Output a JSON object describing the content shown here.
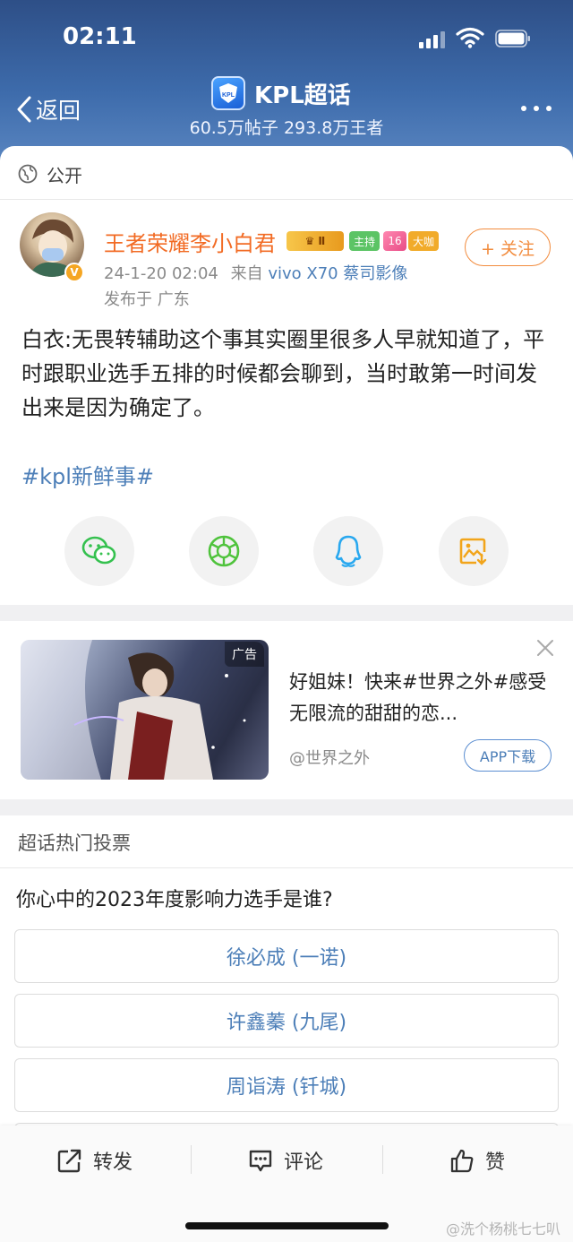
{
  "status_bar": {
    "time": "02:11"
  },
  "header": {
    "back_label": "返回",
    "topic_title": "KPL超话",
    "stats": "60.5万帖子 293.8万王者"
  },
  "post": {
    "visibility": "公开",
    "author": {
      "name": "王者荣耀李小白君",
      "badges": [
        "Ⅱ",
        "主持",
        "16",
        "大咖"
      ]
    },
    "timestamp": "24-1-20 02:04",
    "source_prefix": "来自",
    "source_device": "vivo X70 蔡司影像",
    "location": "发布于 广东",
    "follow_label": "+ 关注",
    "content": "白衣:无畏转辅助这个事其实圈里很多人早就知道了，平时跟职业选手五排的时候都会聊到，当时敢第一时间发出来是因为确定了。",
    "hashtag": "#kpl新鲜事#",
    "share_targets": [
      "wechat-icon",
      "moments-icon",
      "qq-icon",
      "save-image-icon"
    ]
  },
  "ad": {
    "tag": "广告",
    "text": "好姐妹！快来#世界之外#感受无限流的甜甜的恋...",
    "source": "@世界之外",
    "download_label": "APP下载"
  },
  "vote": {
    "section_title": "超话热门投票",
    "question": "你心中的2023年度影响力选手是谁?",
    "options": [
      "徐必成 (一诺)",
      "许鑫蓁 (九尾)",
      "周诣涛 (钎城)"
    ]
  },
  "bottom_bar": {
    "repost_label": "转发",
    "comment_label": "评论",
    "like_label": "赞"
  },
  "watermark": "@洗个杨桃七七叭",
  "colors": {
    "header_blue": "#3d6bab",
    "link_blue": "#4d7fb8",
    "username_orange": "#f26b24",
    "follow_orange": "#f28c3e"
  }
}
